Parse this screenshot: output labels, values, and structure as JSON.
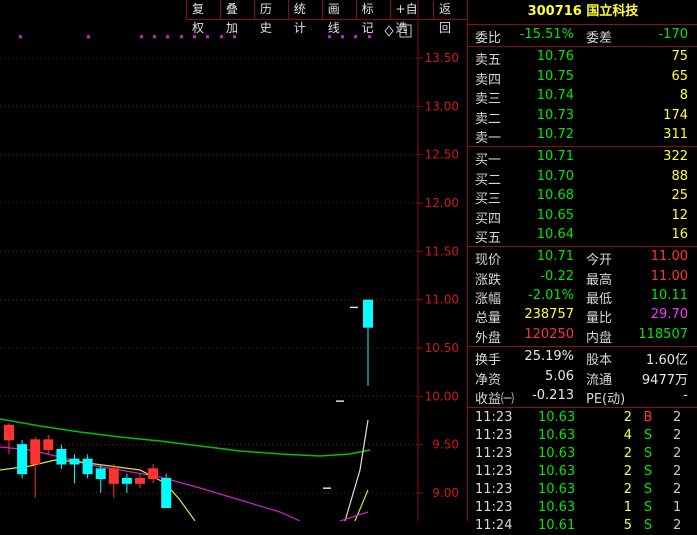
{
  "toolbar": {
    "buttons": [
      "复权",
      "叠加",
      "历史",
      "统计",
      "画线",
      "标记",
      "+自选",
      "返回"
    ]
  },
  "chart": {
    "y_axis_labels": [
      "13.50",
      "13.00",
      "12.50",
      "12.00",
      "11.50",
      "11.00",
      "10.50",
      "10.00",
      "9.50",
      "9.00"
    ],
    "colors": {
      "up": "#ff3333",
      "down": "#00ffff",
      "ma_green": "#00c000",
      "ma_magenta": "#d020d0",
      "ma_yellow": "#e0e040",
      "grid": "#8a1010"
    }
  },
  "chart_data": {
    "type": "candlestick",
    "y_range": [
      8.85,
      13.75
    ],
    "ticks": [
      13.5,
      13.0,
      12.5,
      12.0,
      11.5,
      11.0,
      10.5,
      10.0,
      9.5,
      9.0
    ],
    "markers_y": 13.72,
    "candles": [
      {
        "o": 9.55,
        "c": 9.7,
        "h": 9.72,
        "l": 9.4,
        "up": true
      },
      {
        "o": 9.5,
        "c": 9.2,
        "h": 9.55,
        "l": 9.15,
        "up": false
      },
      {
        "o": 9.3,
        "c": 9.55,
        "h": 9.58,
        "l": 8.95,
        "up": true
      },
      {
        "o": 9.45,
        "c": 9.55,
        "h": 9.6,
        "l": 9.4,
        "up": true
      },
      {
        "o": 9.45,
        "c": 9.3,
        "h": 9.5,
        "l": 9.25,
        "up": false
      },
      {
        "o": 9.35,
        "c": 9.3,
        "h": 9.4,
        "l": 9.1,
        "up": false
      },
      {
        "o": 9.35,
        "c": 9.2,
        "h": 9.4,
        "l": 9.15,
        "up": false
      },
      {
        "o": 9.25,
        "c": 9.15,
        "h": 9.3,
        "l": 9.0,
        "up": false
      },
      {
        "o": 9.1,
        "c": 9.25,
        "h": 9.3,
        "l": 8.95,
        "up": true
      },
      {
        "o": 9.15,
        "c": 9.1,
        "h": 9.2,
        "l": 9.0,
        "up": false
      },
      {
        "o": 9.1,
        "c": 9.15,
        "h": 9.2,
        "l": 9.05,
        "up": true
      },
      {
        "o": 9.15,
        "c": 9.25,
        "h": 9.3,
        "l": 9.1,
        "up": true
      },
      {
        "o": 9.15,
        "c": 8.85,
        "h": 9.2,
        "l": 8.85,
        "up": false
      }
    ],
    "late_candles": [
      {
        "label": "dash1",
        "price": 9.05
      },
      {
        "label": "dash2",
        "price": 9.95
      },
      {
        "label": "dash3",
        "price": 10.92
      }
    ],
    "last_candle": {
      "o": 10.71,
      "c": 11.0,
      "h": 11.0,
      "l": 10.11,
      "up": false
    }
  },
  "quote": {
    "code": "300716",
    "name": "国立科技",
    "weibi_label": "委比",
    "weibi": "-15.51%",
    "weicha_label": "委差",
    "weicha": "-170",
    "asks": [
      {
        "label": "卖五",
        "price": "10.76",
        "vol": "75"
      },
      {
        "label": "卖四",
        "price": "10.75",
        "vol": "65"
      },
      {
        "label": "卖三",
        "price": "10.74",
        "vol": "8"
      },
      {
        "label": "卖二",
        "price": "10.73",
        "vol": "174"
      },
      {
        "label": "卖一",
        "price": "10.72",
        "vol": "311"
      }
    ],
    "bids": [
      {
        "label": "买一",
        "price": "10.71",
        "vol": "322"
      },
      {
        "label": "买二",
        "price": "10.70",
        "vol": "88"
      },
      {
        "label": "买三",
        "price": "10.68",
        "vol": "25"
      },
      {
        "label": "买四",
        "price": "10.65",
        "vol": "12"
      },
      {
        "label": "买五",
        "price": "10.64",
        "vol": "16"
      }
    ],
    "stats": {
      "xianjia_label": "现价",
      "xianjia": "10.71",
      "jinkai_label": "今开",
      "jinkai": "11.00",
      "zhangdie_label": "涨跌",
      "zhangdie": "-0.22",
      "zuigao_label": "最高",
      "zuigao": "11.00",
      "zhangfu_label": "涨幅",
      "zhangfu": "-2.01%",
      "zuidi_label": "最低",
      "zuidi": "10.11",
      "zongliang_label": "总量",
      "zongliang": "238757",
      "liangbi_label": "量比",
      "liangbi": "29.70",
      "waipan_label": "外盘",
      "waipan": "120250",
      "neipan_label": "内盘",
      "neipan": "118507"
    },
    "fundamentals": {
      "huanshou_label": "换手",
      "huanshou": "25.19%",
      "guben_label": "股本",
      "guben": "1.60亿",
      "jingzi_label": "净资",
      "jingzi": "5.06",
      "liutong_label": "流通",
      "liutong": "9477万",
      "shouyi_label": "收益㈠",
      "shouyi": "-0.213",
      "pe_label": "PE(动)",
      "pe": "-"
    },
    "ticks": [
      {
        "time": "11:23",
        "price": "10.63",
        "vol": "2",
        "bs": "B",
        "n": "2"
      },
      {
        "time": "11:23",
        "price": "10.63",
        "vol": "4",
        "bs": "S",
        "n": "2"
      },
      {
        "time": "11:23",
        "price": "10.63",
        "vol": "2",
        "bs": "S",
        "n": "2"
      },
      {
        "time": "11:23",
        "price": "10.63",
        "vol": "2",
        "bs": "S",
        "n": "2"
      },
      {
        "time": "11:23",
        "price": "10.63",
        "vol": "2",
        "bs": "S",
        "n": "2"
      },
      {
        "time": "11:23",
        "price": "10.63",
        "vol": "1",
        "bs": "S",
        "n": "1"
      },
      {
        "time": "11:24",
        "price": "10.61",
        "vol": "5",
        "bs": "S",
        "n": "2"
      }
    ]
  }
}
